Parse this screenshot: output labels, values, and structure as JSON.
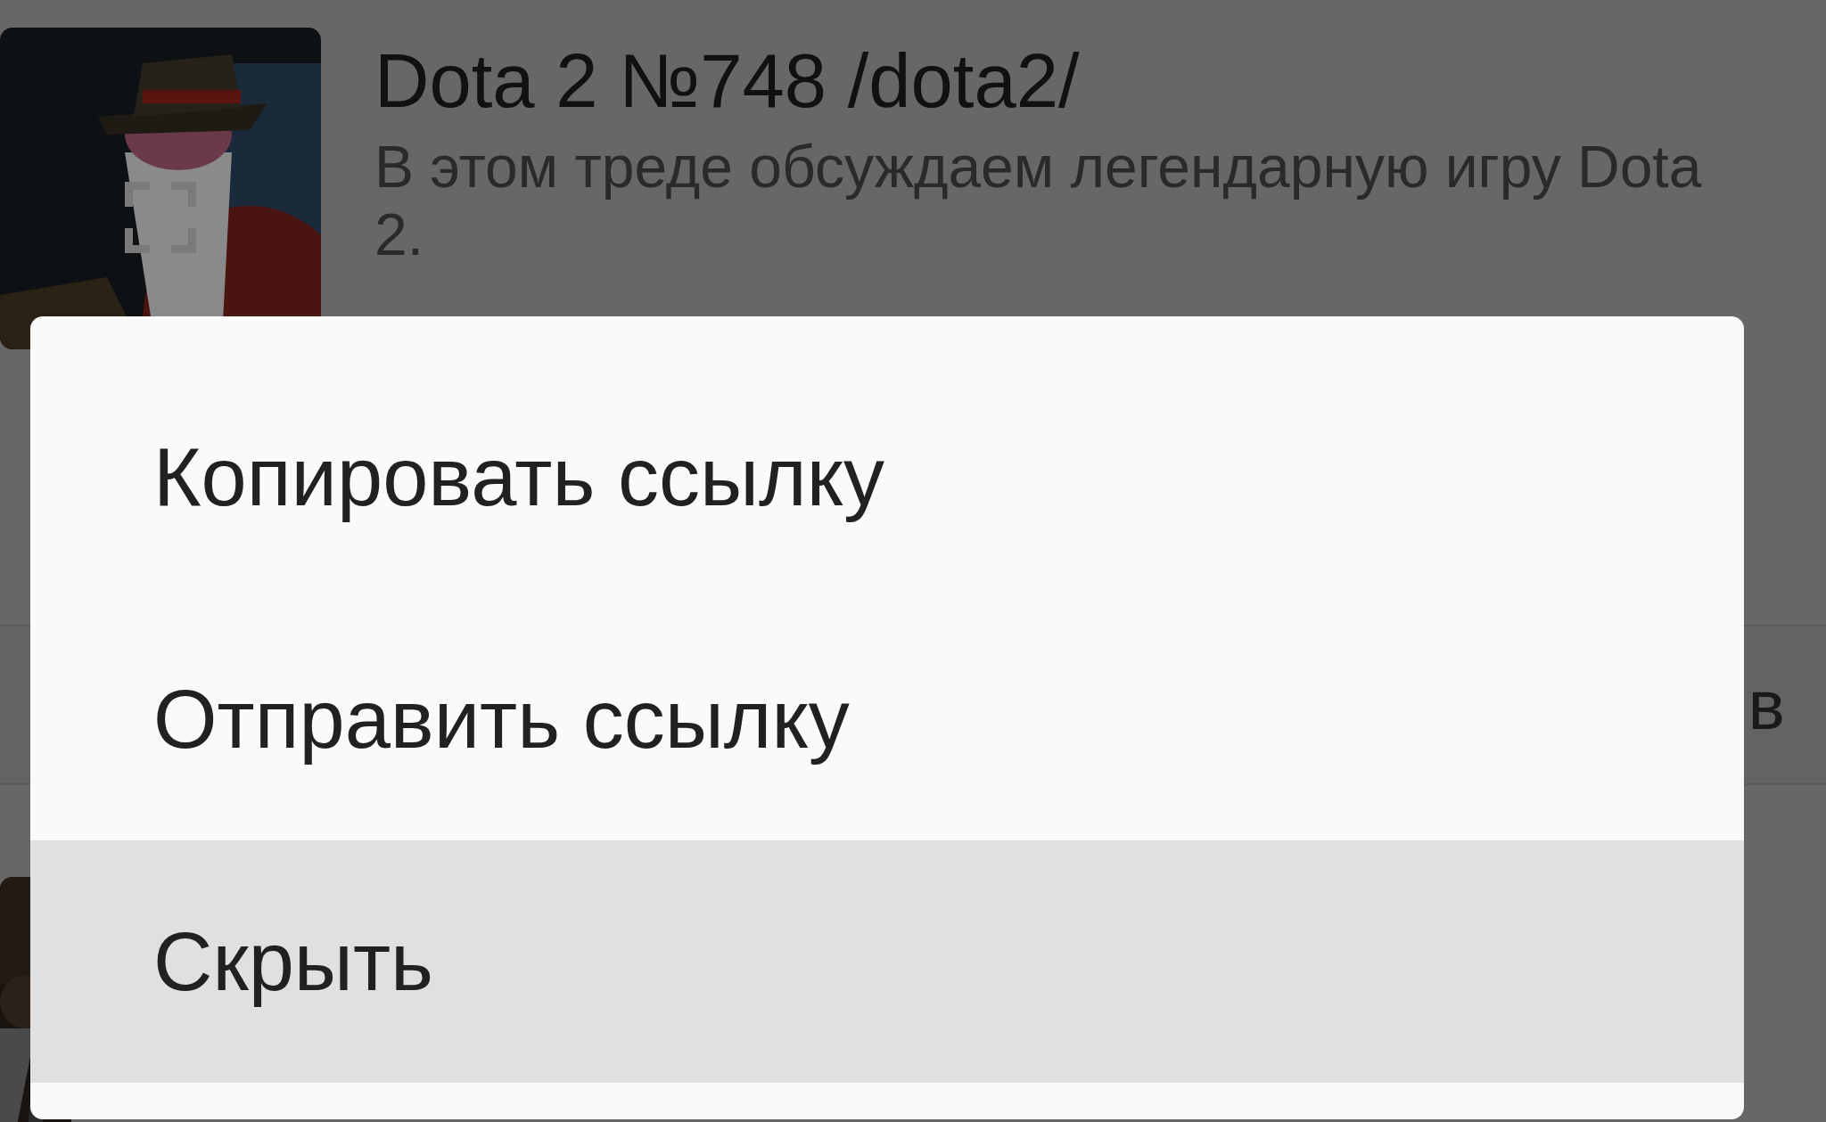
{
  "thread": {
    "title": "Dota 2 №748 /dota2/",
    "description_lines": [
      "В этом треде обсуждаем легендарную игру Dota 2."
    ]
  },
  "next_row": {
    "text_fragment": "в"
  },
  "menu": {
    "items": [
      {
        "label": "Копировать ссылку",
        "selected": false
      },
      {
        "label": "Отправить ссылку",
        "selected": false
      },
      {
        "label": "Скрыть",
        "selected": true
      }
    ]
  }
}
